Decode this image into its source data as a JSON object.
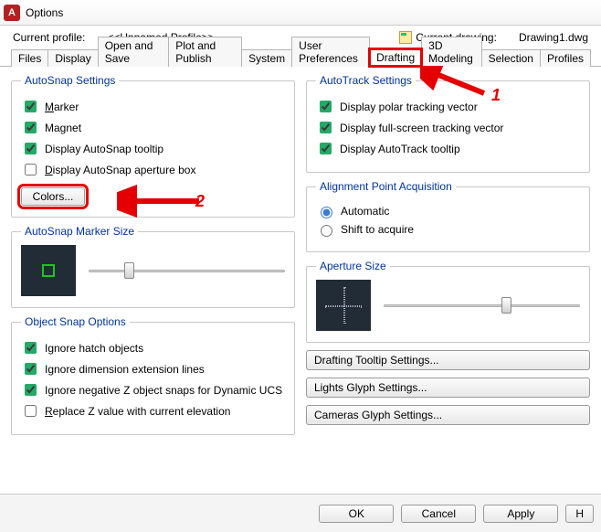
{
  "window": {
    "title": "Options",
    "icon_letter": "A"
  },
  "infobar": {
    "profile_label": "Current profile:",
    "profile_value": "<<Unnamed Profile>>",
    "drawing_label": "Current drawing:",
    "drawing_value": "Drawing1.dwg"
  },
  "tabs": [
    "Files",
    "Display",
    "Open and Save",
    "Plot and Publish",
    "System",
    "User Preferences",
    "Drafting",
    "3D Modeling",
    "Selection",
    "Profiles"
  ],
  "active_tab": "Drafting",
  "autosnap": {
    "legend": "AutoSnap Settings",
    "marker": "Marker",
    "magnet": "Magnet",
    "tooltip": "Display AutoSnap tooltip",
    "aperture": "Display AutoSnap aperture box",
    "colors_btn": "Colors..."
  },
  "markersize": {
    "legend": "AutoSnap Marker Size"
  },
  "objsnap": {
    "legend": "Object Snap Options",
    "hatch": "Ignore hatch objects",
    "dimext": "Ignore dimension extension lines",
    "negz": "Ignore negative Z object snaps for Dynamic UCS",
    "replace": "Replace Z value with current elevation"
  },
  "autotrack": {
    "legend": "AutoTrack Settings",
    "polar": "Display polar tracking vector",
    "full": "Display full-screen tracking vector",
    "tooltip": "Display AutoTrack tooltip"
  },
  "align": {
    "legend": "Alignment Point Acquisition",
    "auto": "Automatic",
    "shift": "Shift to acquire"
  },
  "apsize": {
    "legend": "Aperture Size"
  },
  "extra_buttons": {
    "draft_tooltip": "Drafting Tooltip Settings...",
    "lights": "Lights Glyph Settings...",
    "cameras": "Cameras Glyph Settings..."
  },
  "footer": {
    "ok": "OK",
    "cancel": "Cancel",
    "apply": "Apply",
    "help": "H"
  },
  "annotations": {
    "one": "1",
    "two": "2"
  }
}
